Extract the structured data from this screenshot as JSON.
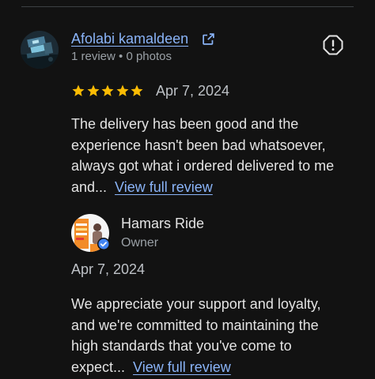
{
  "review": {
    "reviewer_name": "Afolabi kamaldeen",
    "reviewer_meta": "1 review • 0 photos",
    "rating": 5,
    "rating_max": 5,
    "date": "Apr 7, 2024",
    "text_lines": [
      "The delivery has been good and the",
      "experience hasn't been bad whatsoever,",
      "always got what i ordered delivered to me",
      "and..."
    ],
    "view_full_label": "View full review",
    "icons": {
      "external": "external-link-icon",
      "report": "report-icon",
      "star": "star-icon"
    }
  },
  "owner_response": {
    "name": "Hamars Ride",
    "role": "Owner",
    "date": "Apr 7, 2024",
    "text_lines": [
      "We appreciate your support and loyalty,",
      "and we're committed to maintaining the",
      "high standards that you've come to",
      "expect..."
    ],
    "view_full_label": "View full review",
    "verified_icon": "verified-check-icon"
  },
  "colors": {
    "background": "#121212",
    "link": "#8ab4f8",
    "star": "#fbbc04",
    "text": "#e3e3e3",
    "muted": "#9aa0a6",
    "verified": "#4285f4"
  }
}
